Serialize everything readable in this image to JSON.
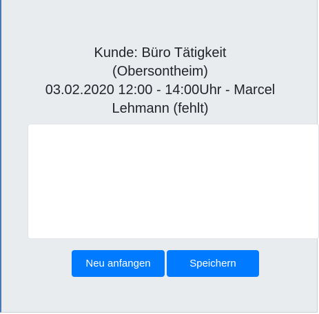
{
  "header": {
    "line1": "Kunde: Büro Tätigkeit",
    "line2": "(Obersontheim)",
    "line3": "03.02.2020 12:00 - 14:00Uhr - Marcel",
    "line4": "Lehmann (fehlt)"
  },
  "buttons": {
    "reset_label": "Neu anfangen",
    "save_label": "Speichern"
  },
  "colors": {
    "primary": "#007bff",
    "background": "#e9ecef",
    "text": "#212529"
  }
}
